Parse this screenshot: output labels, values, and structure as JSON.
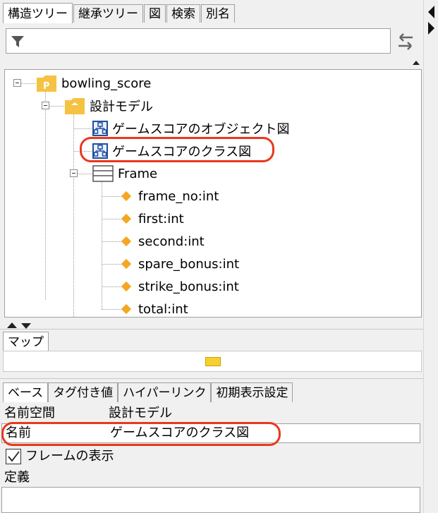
{
  "top_tabs": [
    "構造ツリー",
    "継承ツリー",
    "図",
    "検索",
    "別名"
  ],
  "filter": {
    "value": ""
  },
  "tree": {
    "project": "bowling_score",
    "model": "設計モデル",
    "diagram1": "ゲームスコアのオブジェクト図",
    "diagram2": "ゲームスコアのクラス図",
    "class_name": "Frame",
    "attributes": [
      "frame_no:int",
      "first:int",
      "second:int",
      "spare_bonus:int",
      "strike_bonus:int",
      "total:int"
    ]
  },
  "map": {
    "tab": "マップ"
  },
  "props": {
    "tabs": [
      "ベース",
      "タグ付き値",
      "ハイパーリンク",
      "初期表示設定"
    ],
    "namespace_label": "名前空間",
    "namespace_value": "設計モデル",
    "name_label": "名前",
    "name_value": "ゲームスコアのクラス図",
    "show_frame_label": "フレームの表示",
    "show_frame_checked": true,
    "definition_label": "定義",
    "definition_value": ""
  },
  "colors": {
    "highlight": "#e8391d",
    "folder": "#f5c242",
    "diamond": "#f5a623",
    "diagram_icon": "#1f4fa0"
  }
}
